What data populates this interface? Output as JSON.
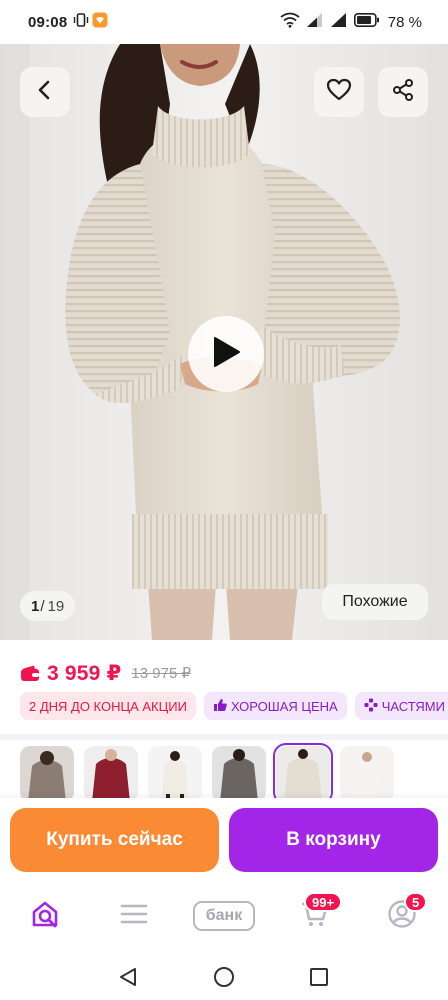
{
  "status_bar": {
    "time": "09:08",
    "battery_percent": "78 %",
    "icons": [
      "vibrate-icon",
      "notification-app-icon",
      "wifi-icon",
      "signal-icon",
      "signal-icon",
      "battery-icon"
    ]
  },
  "gallery": {
    "current_index": "1",
    "separator": "/",
    "total": "19",
    "similar_label": "Похожие",
    "icons": [
      "chevron-left-icon",
      "heart-icon",
      "share-icon",
      "play-icon"
    ]
  },
  "price": {
    "current": "3 959 ₽",
    "old": "13 975 ₽",
    "accent_color": "#f1154f"
  },
  "badges": [
    {
      "label": "2 ДНЯ ДО КОНЦА АКЦИИ"
    },
    {
      "label": "ХОРОШАЯ ЦЕНА"
    },
    {
      "label": "ЧАСТЯМИ"
    }
  ],
  "actions": {
    "buy_now": "Купить сейчас",
    "add_to_cart": "В корзину",
    "buy_color": "#fb8a34",
    "cart_color": "#a326e8"
  },
  "bottom_nav": {
    "bank_label": "банк",
    "cart_badge": "99+",
    "profile_badge": "5"
  }
}
